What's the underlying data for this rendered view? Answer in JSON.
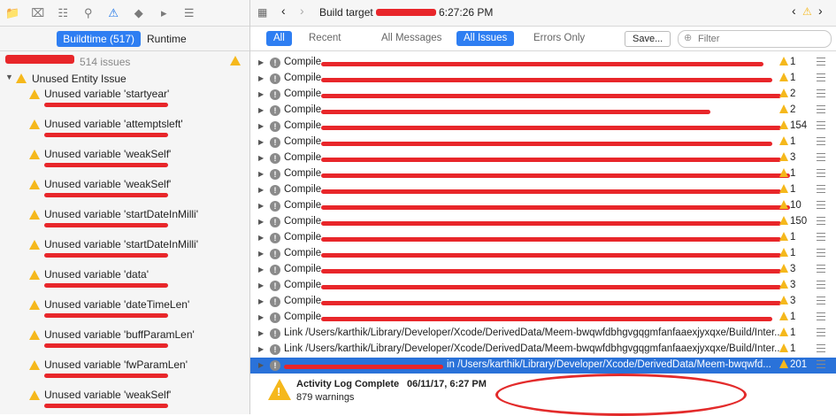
{
  "left": {
    "nav_icons": [
      "folder-icon",
      "x-box-icon",
      "hierarchy-icon",
      "search-icon",
      "warning-icon",
      "diamond-icon",
      "tag-icon",
      "comment-icon"
    ],
    "tabs": [
      "Buildtime (517)",
      "Runtime"
    ],
    "issue_count": "514 issues",
    "category": "Unused Entity Issue",
    "issues": [
      "Unused variable 'startyear'",
      "Unused variable 'attemptsleft'",
      "Unused variable 'weakSelf'",
      "Unused variable 'weakSelf'",
      "Unused variable 'startDateInMilli'",
      "Unused variable 'startDateInMilli'",
      "Unused variable 'data'",
      "Unused variable 'dateTimeLen'",
      "Unused variable 'buffParamLen'",
      "Unused variable 'fwParamLen'",
      "Unused variable 'weakSelf'"
    ]
  },
  "toolbar": {
    "title": "Build target",
    "time": "6:27:26 PM"
  },
  "filter": {
    "all": "All",
    "recent": "Recent",
    "all_messages": "All Messages",
    "all_issues": "All Issues",
    "errors_only": "Errors Only",
    "save": "Save...",
    "placeholder": "Filter"
  },
  "rows": [
    {
      "text": "Compile",
      "count": "1"
    },
    {
      "text": "Compile",
      "count": "1"
    },
    {
      "text": "Compile",
      "count": "2"
    },
    {
      "text": "Compile",
      "count": "2"
    },
    {
      "text": "Compile",
      "count": "154"
    },
    {
      "text": "Compile",
      "count": "1"
    },
    {
      "text": "Compile",
      "count": "3"
    },
    {
      "text": "Compile",
      "count": "1"
    },
    {
      "text": "Compile",
      "count": "1"
    },
    {
      "text": "Compile",
      "count": "10"
    },
    {
      "text": "Compile",
      "count": "150"
    },
    {
      "text": "Compile",
      "count": "1"
    },
    {
      "text": "Compile",
      "count": "1"
    },
    {
      "text": "Compile",
      "count": "3"
    },
    {
      "text": "Compile",
      "count": "3"
    },
    {
      "text": "Compile",
      "count": "3"
    },
    {
      "text": "Compile",
      "count": "1"
    },
    {
      "text": "Link /Users/karthik/Library/Developer/Xcode/DerivedData/Meem-bwqwfdbhgvgqgmfanfaaexjyxqxe/Build/Inter...",
      "count": "1"
    },
    {
      "text": "Link /Users/karthik/Library/Developer/Xcode/DerivedData/Meem-bwqwfdbhgvgqgmfanfaaexjyxqxe/Build/Inter...",
      "count": "1"
    },
    {
      "text": "in /Users/karthik/Library/Developer/Xcode/DerivedData/Meem-bwqwfd...",
      "count": "201"
    }
  ],
  "summary": {
    "title": "Activity Log Complete",
    "date": "06/11/17, 6:27 PM",
    "warnings": "879 warnings"
  }
}
